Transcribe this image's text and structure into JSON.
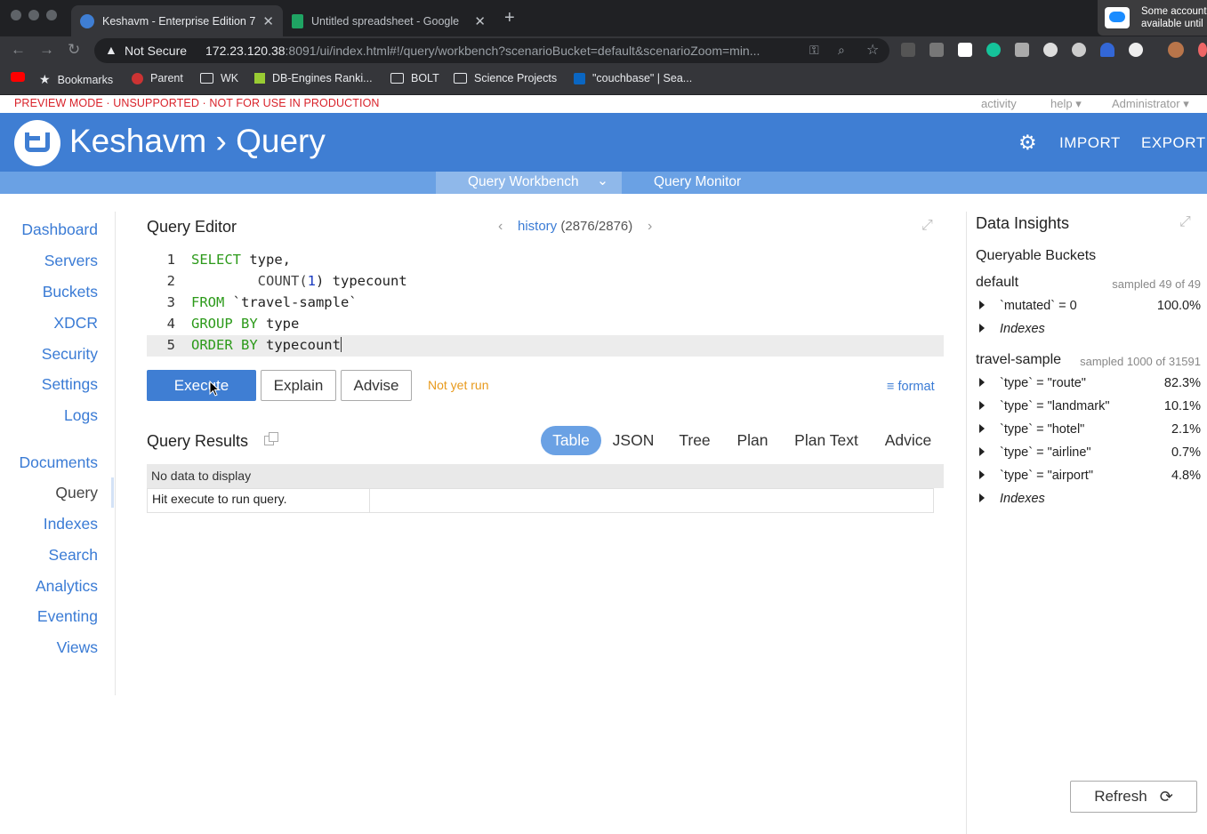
{
  "browser": {
    "tabs": [
      {
        "title": "Keshavm - Enterprise Edition 7",
        "active": true
      },
      {
        "title": "Untitled spreadsheet - Google",
        "active": false
      }
    ],
    "new_tab": "+",
    "close": "✕",
    "security": "Not Secure",
    "url_host": "172.23.120.38",
    "url_rest": ":8091/ui/index.html#!/query/workbench?scenarioBucket=default&scenarioZoom=min...",
    "notification": {
      "line1": "Some account",
      "line2": "available until"
    },
    "bookmarks": [
      "Bookmarks",
      "Parent",
      "WK",
      "DB-Engines Ranki...",
      "BOLT",
      "Science Projects",
      "\"couchbase\" | Sea..."
    ],
    "colors": {
      "chrome_dark": "#202124",
      "chrome_mid": "#35363a"
    }
  },
  "banner": {
    "preview": "PREVIEW MODE · UNSUPPORTED · NOT FOR USE IN PRODUCTION",
    "activity": "activity",
    "help": "help",
    "admin": "Administrator",
    "caret": "▾"
  },
  "header": {
    "title": "Keshavm › Query",
    "import": "IMPORT",
    "export": "EXPORT",
    "accent": "#3f7ed3"
  },
  "subnav": {
    "workbench": "Query Workbench",
    "monitor": "Query Monitor",
    "caret": "⌄"
  },
  "sidebar": {
    "items": [
      "Dashboard",
      "Servers",
      "Buckets",
      "XDCR",
      "Security",
      "Settings",
      "Logs"
    ],
    "items2": [
      "Documents",
      "Query",
      "Indexes",
      "Search",
      "Analytics",
      "Eventing",
      "Views"
    ],
    "active": "Query"
  },
  "editor": {
    "title": "Query Editor",
    "history_label": "history",
    "history_count": "(2876/2876)",
    "prev": "‹",
    "next": "›",
    "lines": [
      {
        "num": "1",
        "kw": "SELECT",
        "rest": " type,"
      },
      {
        "num": "2",
        "indent": "        ",
        "fn": "COUNT(",
        "n": "1",
        "rest": ") typecount"
      },
      {
        "num": "3",
        "kw": "FROM",
        "rest": " `travel-sample`"
      },
      {
        "num": "4",
        "kw": "GROUP BY",
        "rest": " type"
      },
      {
        "num": "5",
        "kw": "ORDER BY",
        "rest": " typecount"
      }
    ]
  },
  "actions": {
    "execute": "Execute",
    "explain": "Explain",
    "advise": "Advise",
    "status": "Not yet run",
    "format": "format"
  },
  "results": {
    "title": "Query Results",
    "tabs": [
      "Table",
      "JSON",
      "Tree",
      "Plan",
      "Plan Text",
      "Advice"
    ],
    "active_tab": "Table",
    "no_data": "No data to display",
    "hint": "Hit execute to run query."
  },
  "insights": {
    "title": "Data Insights",
    "subtitle": "Queryable Buckets",
    "buckets": [
      {
        "name": "default",
        "sampled": "sampled 49 of 49",
        "rows": [
          {
            "k": "`mutated` = 0",
            "v": "100.0%"
          },
          {
            "k": "Indexes",
            "v": "",
            "italic": true
          }
        ]
      },
      {
        "name": "travel-sample",
        "sampled": "sampled 1000 of 31591",
        "rows": [
          {
            "k": "`type` = \"route\"",
            "v": "82.3%"
          },
          {
            "k": "`type` = \"landmark\"",
            "v": "10.1%"
          },
          {
            "k": "`type` = \"hotel\"",
            "v": "2.1%"
          },
          {
            "k": "`type` = \"airline\"",
            "v": "0.7%"
          },
          {
            "k": "`type` = \"airport\"",
            "v": "4.8%"
          },
          {
            "k": "Indexes",
            "v": "",
            "italic": true
          }
        ]
      }
    ],
    "refresh": "Refresh"
  }
}
